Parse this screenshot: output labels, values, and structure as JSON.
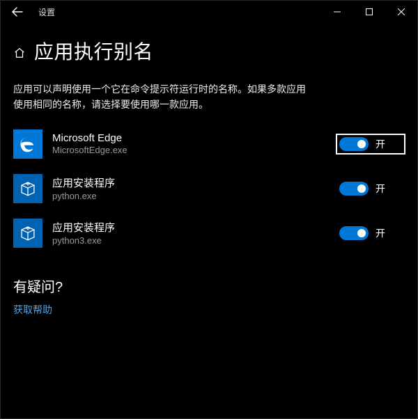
{
  "window": {
    "title": "设置"
  },
  "page": {
    "heading": "应用执行别名",
    "description": "应用可以声明使用一个它在命令提示符运行时的名称。如果多款应用使用相同的名称，请选择要使用哪一款应用。"
  },
  "apps": [
    {
      "name": "Microsoft Edge",
      "file": "MicrosoftEdge.exe",
      "toggle_label": "开",
      "icon": "edge",
      "focused": true
    },
    {
      "name": "应用安装程序",
      "file": "python.exe",
      "toggle_label": "开",
      "icon": "installer",
      "focused": false
    },
    {
      "name": "应用安装程序",
      "file": "python3.exe",
      "toggle_label": "开",
      "icon": "installer",
      "focused": false
    }
  ],
  "help": {
    "heading": "有疑问?",
    "link": "获取帮助"
  }
}
